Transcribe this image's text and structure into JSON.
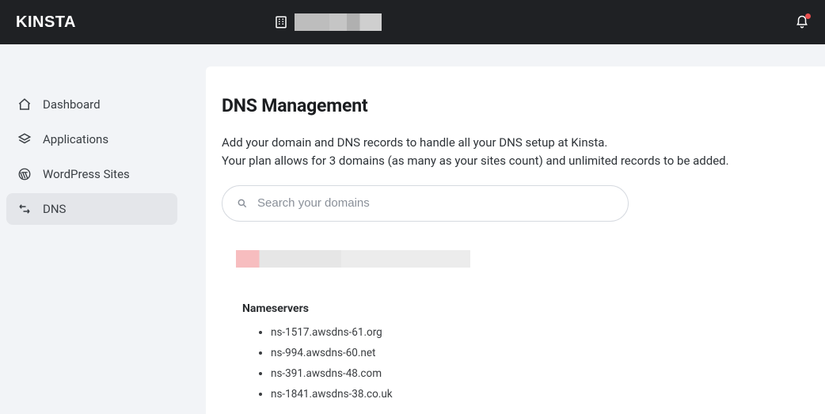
{
  "brand": "KINSTA",
  "sidebar": {
    "items": [
      {
        "label": "Dashboard"
      },
      {
        "label": "Applications"
      },
      {
        "label": "WordPress Sites"
      },
      {
        "label": "DNS"
      }
    ]
  },
  "page": {
    "title": "DNS Management",
    "desc_line1": "Add your domain and DNS records to handle all your DNS setup at Kinsta.",
    "desc_line2": "Your plan allows for 3 domains (as many as your sites count) and unlimited records to be added."
  },
  "search": {
    "placeholder": "Search your domains"
  },
  "nameservers": {
    "heading": "Nameservers",
    "items": [
      "ns-1517.awsdns-61.org",
      "ns-994.awsdns-60.net",
      "ns-391.awsdns-48.com",
      "ns-1841.awsdns-38.co.uk"
    ]
  }
}
